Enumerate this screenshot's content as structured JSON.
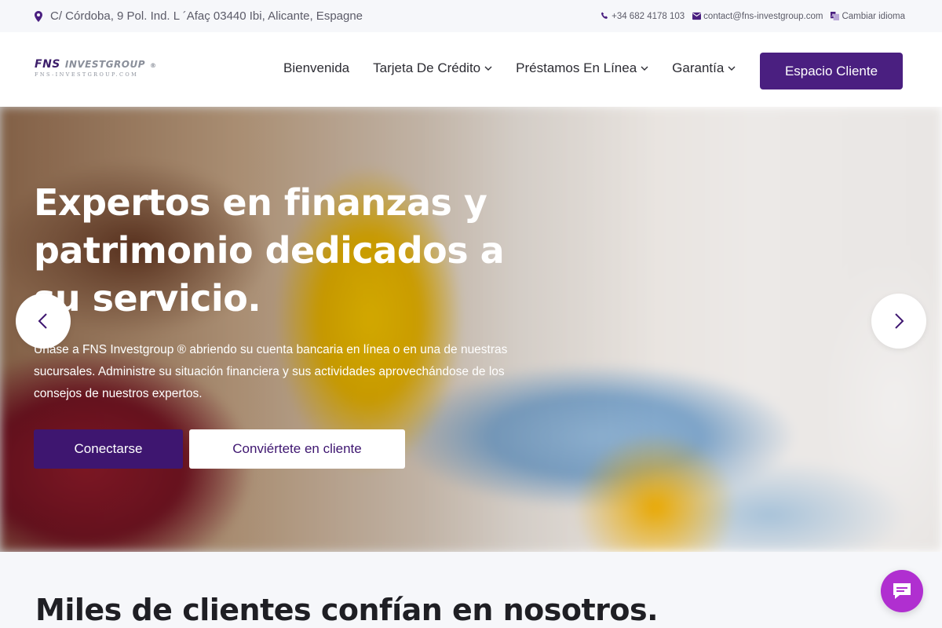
{
  "topbar": {
    "address": "C/ Córdoba, 9 Pol. Ind. L ´Afaç 03440 Ibi, Alicante, Espagne",
    "phone": "+34 682 4178 103",
    "email": "contact@fns-investgroup.com",
    "language": "Cambiar idioma"
  },
  "logo": {
    "brand_a": "FNS",
    "brand_b": "INVESTGROUP",
    "reg_mark": "®",
    "subtitle": "FNS-INVESTGROUP.COM"
  },
  "nav": {
    "items": [
      {
        "label": "Bienvenida",
        "dropdown": false
      },
      {
        "label": "Tarjeta De Crédito",
        "dropdown": true
      },
      {
        "label": "Préstamos En Línea",
        "dropdown": true
      },
      {
        "label": "Garantía",
        "dropdown": true
      }
    ],
    "cta": "Espacio Cliente"
  },
  "hero": {
    "title": "Expertos en finanzas y patrimonio dedicados a su servicio.",
    "text": "Únase a FNS Investgroup ® abriendo su cuenta bancaria en línea o en una de nuestras sucursales. Administre su situación financiera y sus actividades aprovechándose de los consejos de nuestros expertos.",
    "primary_button": "Conectarse",
    "secondary_button": "Conviértete en cliente"
  },
  "section": {
    "title": "Miles de clientes confían en nosotros."
  },
  "colors": {
    "brand": "#4a1f80",
    "primary_button": "#3e1670",
    "chat": "#b02fd0",
    "topbar_bg": "#f6f7fa"
  },
  "icons": [
    "map-pin-icon",
    "phone-icon",
    "envelope-icon",
    "language-icon",
    "chevron-down-icon",
    "chevron-left-icon",
    "chevron-right-icon",
    "chat-icon"
  ]
}
